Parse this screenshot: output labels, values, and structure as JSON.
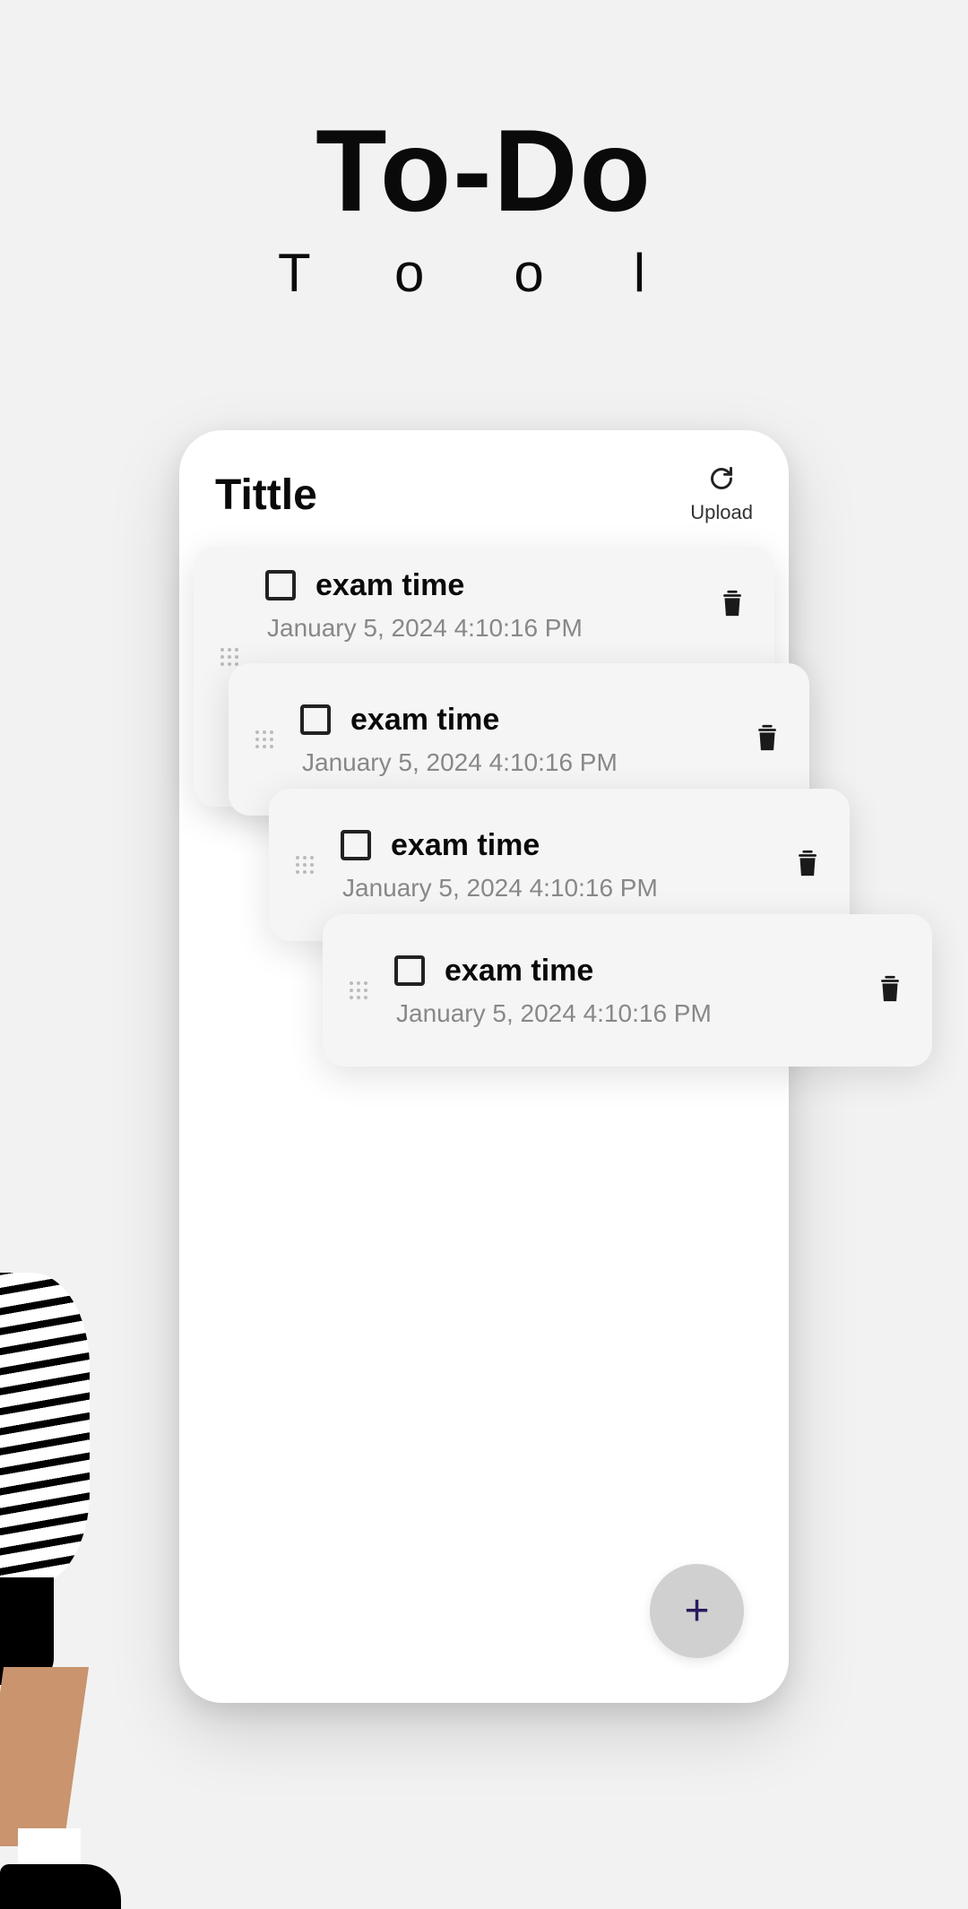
{
  "hero": {
    "title": "To-Do",
    "subtitle": "Tool"
  },
  "app": {
    "header": {
      "title": "Tittle",
      "upload_label": "Upload"
    }
  },
  "todos": [
    {
      "title": "exam time",
      "timestamp": "January 5, 2024 4:10:16 PM"
    },
    {
      "title": "exam time",
      "timestamp": "January 5, 2024 4:10:16 PM"
    },
    {
      "title": "exam time",
      "timestamp": "January 5, 2024 4:10:16 PM"
    },
    {
      "title": "exam time",
      "timestamp": "January 5, 2024 4:10:16 PM"
    }
  ],
  "icons": {
    "refresh": "refresh-icon",
    "trash": "trash-icon",
    "plus": "plus-icon",
    "drag": "drag-handle-icon"
  }
}
